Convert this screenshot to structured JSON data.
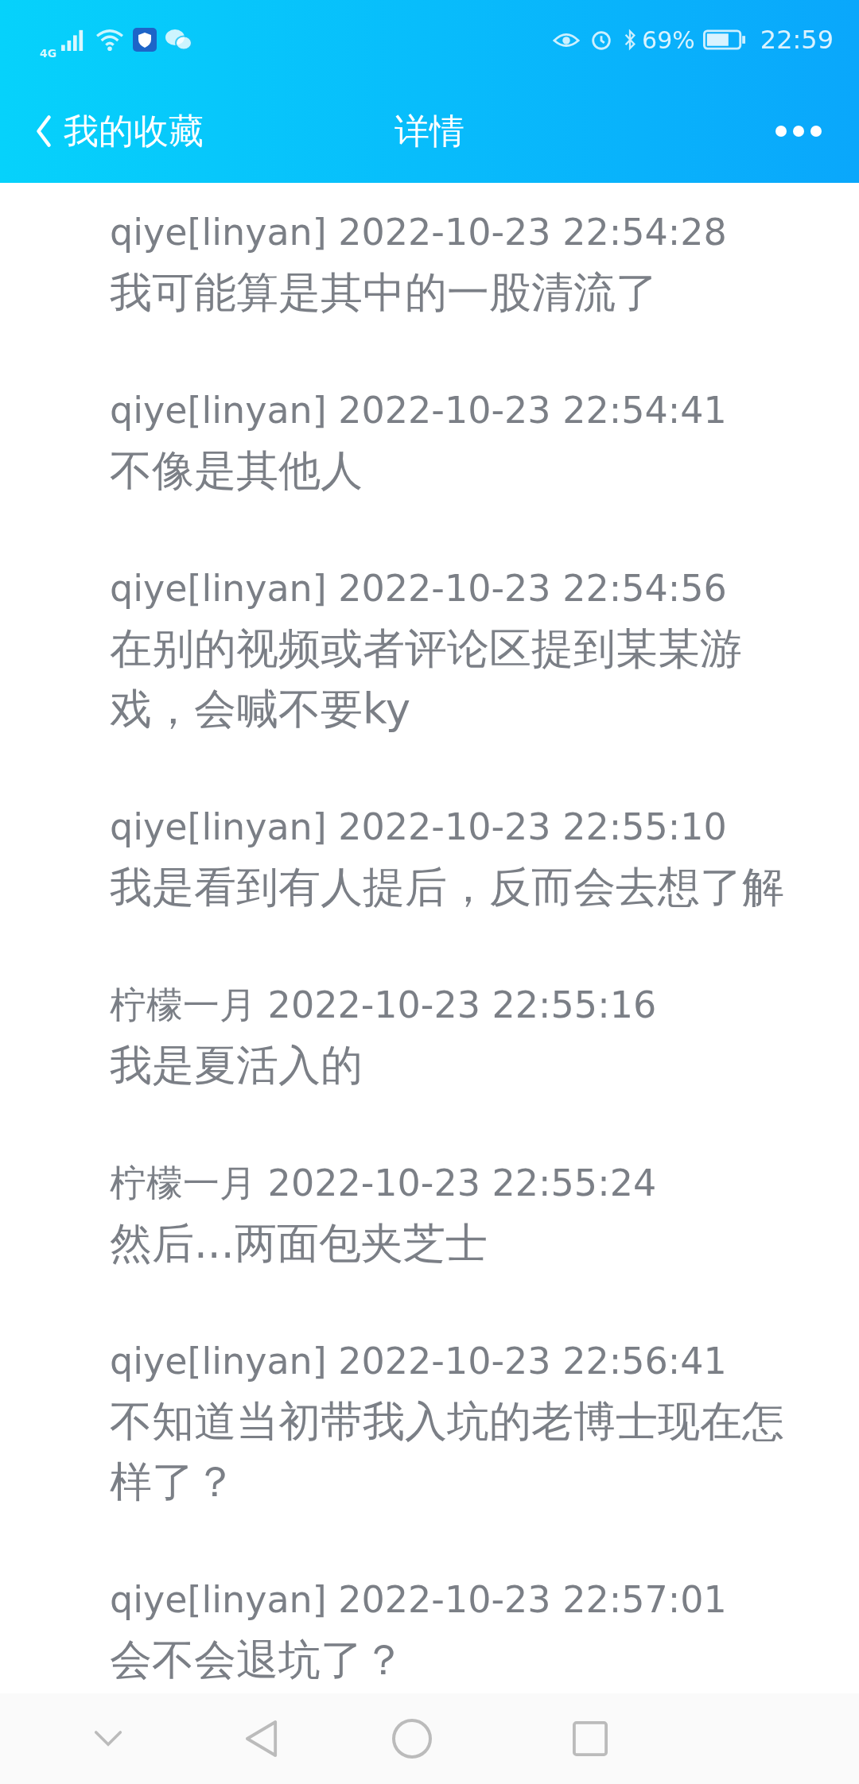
{
  "status_bar": {
    "network": "4G",
    "battery_percent": "69%",
    "time": "22:59"
  },
  "header": {
    "back_label": "我的收藏",
    "title": "详情"
  },
  "messages": [
    {
      "sender": "qiye[linyan] 2022-10-23 22:54:28",
      "text": "我可能算是其中的一股清流了"
    },
    {
      "sender": "qiye[linyan] 2022-10-23 22:54:41",
      "text": "不像是其他人"
    },
    {
      "sender": "qiye[linyan] 2022-10-23 22:54:56",
      "text": "在别的视频或者评论区提到某某游戏，会喊不要ky"
    },
    {
      "sender": "qiye[linyan] 2022-10-23 22:55:10",
      "text": "我是看到有人提后，反而会去想了解"
    },
    {
      "sender": "柠檬一月 2022-10-23 22:55:16",
      "text": "我是夏活入的"
    },
    {
      "sender": "柠檬一月 2022-10-23 22:55:24",
      "text": "然后...两面包夹芝士"
    },
    {
      "sender": "qiye[linyan] 2022-10-23 22:56:41",
      "text": "不知道当初带我入坑的老博士现在怎样了？"
    },
    {
      "sender": "qiye[linyan] 2022-10-23 22:57:01",
      "text": "会不会退坑了？"
    }
  ]
}
